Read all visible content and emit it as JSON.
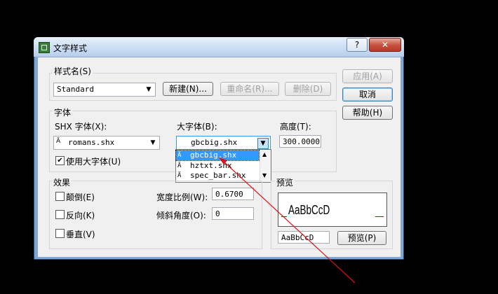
{
  "window": {
    "title": "文字样式",
    "help_button": "?",
    "close_button": "✕"
  },
  "style_name": {
    "label": "样式名(S)",
    "value": "Standard",
    "new_button": "新建(N)...",
    "rename_button": "重命名(R)...",
    "delete_button": "删除(D)"
  },
  "font": {
    "group_label": "字体",
    "shx_label": "SHX 字体(X):",
    "shx_value": "romans.shx",
    "bigfont_label": "大字体(B):",
    "bigfont_value": "gbcbig.shx",
    "height_label": "高度(T):",
    "height_value": "300.0000",
    "use_bigfont_label": "使用大字体(U)",
    "use_bigfont_checked": true
  },
  "dropdown": {
    "items": [
      "gbcbig.shx",
      "hztxt.shx",
      "spec_bar.shx"
    ]
  },
  "effects": {
    "group_label": "效果",
    "upside_down": "颠倒(E)",
    "backwards": "反向(K)",
    "vertical": "垂直(V)",
    "width_factor_label": "宽度比例(W):",
    "width_factor_value": "0.6700",
    "oblique_label": "倾斜角度(O):",
    "oblique_value": "0"
  },
  "preview": {
    "group_label": "预览",
    "sample_text": "AaBbCcD",
    "input_value": "AaBbCcD",
    "button": "预览(P)"
  },
  "buttons": {
    "apply": "应用(A)",
    "cancel": "取消",
    "help": "帮助(H)"
  }
}
